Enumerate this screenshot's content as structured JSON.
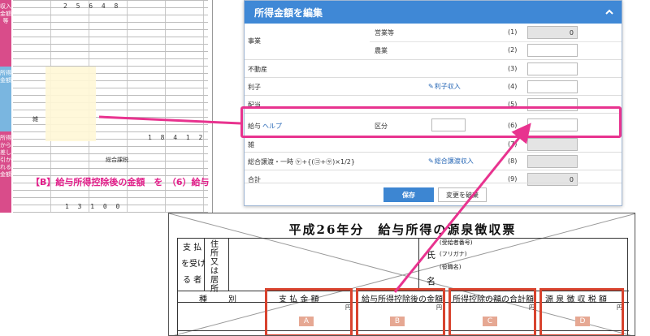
{
  "tax_form": {
    "sidebar_labels": [
      "収入金額等",
      "所得金額",
      "所得から差し引かれる金額"
    ],
    "digits_top": "2 5 6 4 8",
    "digits_mid": "1 8 4 1 2",
    "digits_bottom": "1 3 1 0 0",
    "label_a": "総合課税",
    "label_b": "雑",
    "note": "【B】給与所得控除後の金額　を　（6）給与　に転記"
  },
  "edit_panel": {
    "title": "所得金額を編集",
    "rows": [
      {
        "label": "事業",
        "sub1": "営業等",
        "num1": "(1)",
        "val1": "0",
        "sub2": "農業",
        "num2": "(2)"
      },
      {
        "label": "不動産",
        "num": "(3)"
      },
      {
        "label": "利子",
        "link": "利子収入",
        "num": "(4)"
      },
      {
        "label": "配当",
        "num": "(5)"
      },
      {
        "label": "給与",
        "help": "ヘルプ",
        "sub": "区分",
        "num": "(6)"
      },
      {
        "label": "雑",
        "num": "(7)"
      },
      {
        "label": "総合譲渡・一時 ㋘+{(㋙+㋚)×1/2}",
        "link": "総合譲渡収入",
        "num": "(8)"
      },
      {
        "label": "合計",
        "num": "(9)",
        "val": "0"
      }
    ],
    "save_label": "保存",
    "discard_label": "変更を破棄"
  },
  "slip": {
    "title": "平成26年分　給与所得の源泉徴収票",
    "payer_label_1": "支 払",
    "payer_label_2": "を受け",
    "payer_label_3": "る 者",
    "address_label": "住所又は居所",
    "recipient_1": "氏",
    "recipient_2": "名",
    "field_1": "(受給者番号)",
    "field_2": "(フリガナ)",
    "field_3": "(役職名)",
    "type_label": "種　　別",
    "col_a": "支 払 金 額",
    "col_b": "給与所得控除後の金額",
    "col_c": "所得控除の額の合計額",
    "col_d": "源 泉 徴 収 税 額",
    "letter_a": "A",
    "letter_b": "B",
    "letter_c": "C",
    "letter_d": "D",
    "yen": "円"
  },
  "colors": {
    "panel_header": "#3f88d6",
    "highlight": "#e8338f",
    "slip_box": "#d8432e",
    "link": "#2566b5"
  }
}
